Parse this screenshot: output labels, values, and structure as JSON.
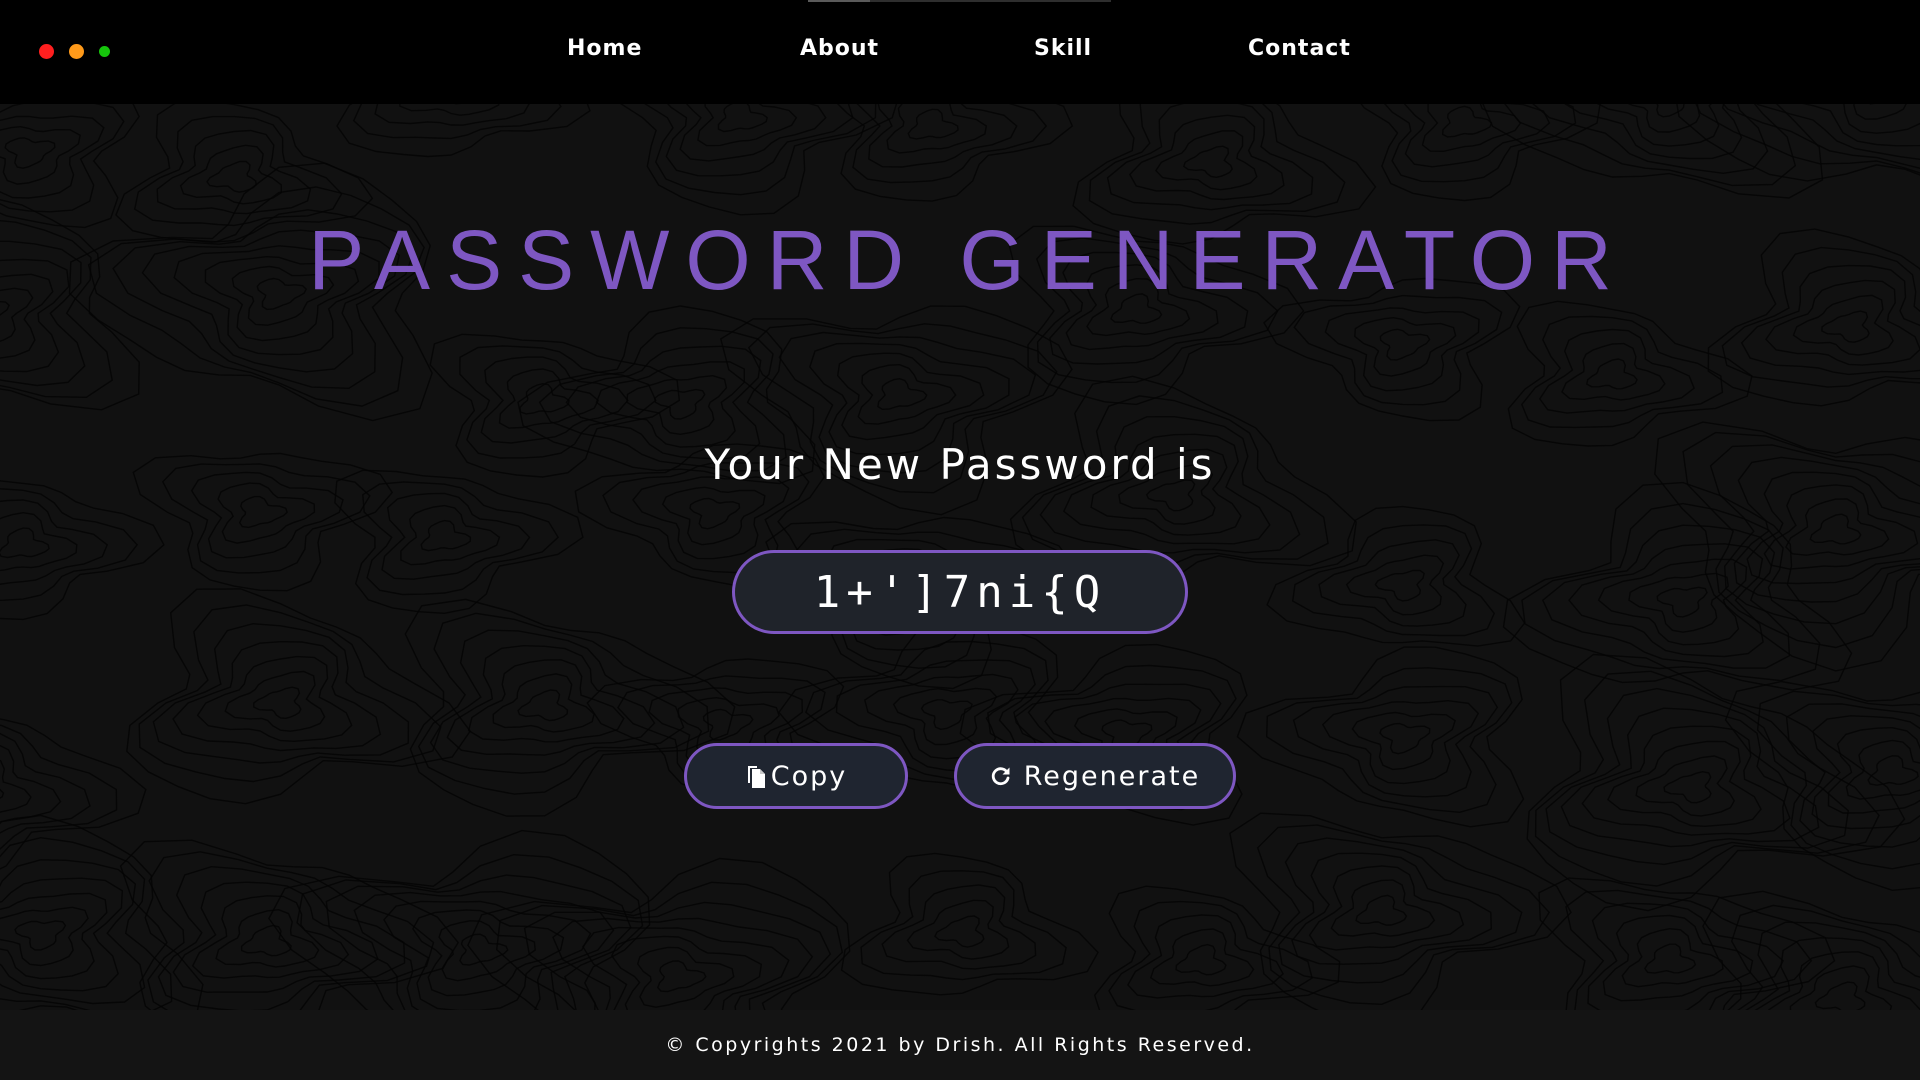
{
  "window": {
    "controls": [
      {
        "name": "close",
        "color": "#ff1f1f"
      },
      {
        "name": "minimize",
        "color": "#ff9a1a"
      },
      {
        "name": "maximize",
        "color": "#16c60c"
      }
    ]
  },
  "nav": {
    "items": [
      {
        "label": "Home"
      },
      {
        "label": "About"
      },
      {
        "label": "Skill"
      },
      {
        "label": "Contact"
      }
    ]
  },
  "main": {
    "title": "PASSWORD GENERATOR",
    "subtitle": "Your New Password is",
    "password_value": "1+']7ni{Q",
    "buttons": {
      "copy": {
        "label": "Copy",
        "icon": "copy-icon"
      },
      "regenerate": {
        "label": "Regenerate",
        "icon": "refresh-icon"
      }
    }
  },
  "footer": {
    "text": "© Copyrights 2021 by Drish. All Rights Reserved."
  },
  "colors": {
    "accent": "#7e57c2",
    "background": "#111111",
    "navbar": "#000000",
    "footer": "#141414",
    "field_fill": "#1f232a"
  }
}
